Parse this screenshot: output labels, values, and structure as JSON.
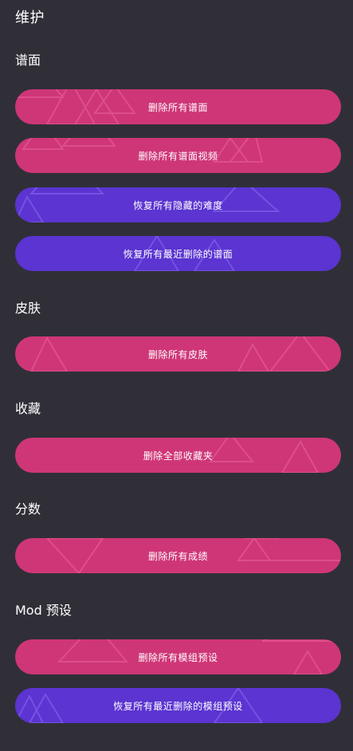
{
  "page": {
    "title": "维护"
  },
  "sections": {
    "charts": {
      "title": "谱面",
      "buttons": [
        {
          "label": "删除所有谱面",
          "color": "#cf3677"
        },
        {
          "label": "删除所有谱面视频",
          "color": "#cf3677"
        },
        {
          "label": "恢复所有隐藏的难度",
          "color": "#5b34d1"
        },
        {
          "label": "恢复所有最近删除的谱面",
          "color": "#5b34d1"
        }
      ]
    },
    "skins": {
      "title": "皮肤",
      "buttons": [
        {
          "label": "删除所有皮肤",
          "color": "#cf3677"
        }
      ]
    },
    "collections": {
      "title": "收藏",
      "buttons": [
        {
          "label": "删除全部收藏夹",
          "color": "#cf3677"
        }
      ]
    },
    "scores": {
      "title": "分数",
      "buttons": [
        {
          "label": "删除所有成绩",
          "color": "#cf3677"
        }
      ]
    },
    "mod_presets": {
      "title": "Mod 预设",
      "buttons": [
        {
          "label": "删除所有模组预设",
          "color": "#cf3677"
        },
        {
          "label": "恢复所有最近删除的模组预设",
          "color": "#5b34d1"
        }
      ]
    }
  },
  "colors": {
    "background": "#302f38",
    "danger": "#cf3677",
    "restore": "#5b34d1"
  }
}
